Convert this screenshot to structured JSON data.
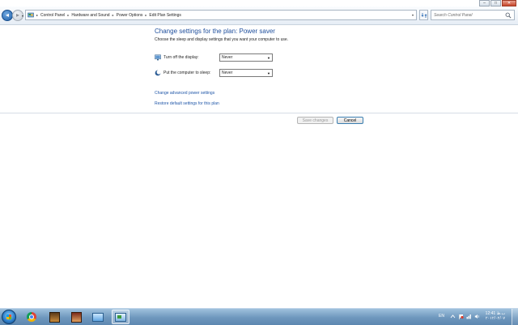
{
  "window_controls": {
    "minimize": "–",
    "maximize": "□",
    "close": "✕"
  },
  "address_bar": {
    "breadcrumbs": [
      "Control Panel",
      "Hardware and Sound",
      "Power Options",
      "Edit Plan Settings"
    ],
    "search_placeholder": "Search Control Panel"
  },
  "content": {
    "title": "Change settings for the plan: Power saver",
    "subtitle": "Choose the sleep and display settings that you want your computer to use.",
    "settings": [
      {
        "label": "Turn off the display:",
        "value": "Never",
        "icon": "monitor-icon"
      },
      {
        "label": "Put the computer to sleep:",
        "value": "Never",
        "icon": "moon-icon"
      }
    ],
    "links": {
      "advanced": "Change advanced power settings",
      "restore": "Restore default settings for this plan"
    },
    "buttons": {
      "save": "Save changes",
      "cancel": "Cancel"
    }
  },
  "taskbar": {
    "apps": [
      "chrome-icon",
      "game-icon",
      "game-icon",
      "remote-desktop-icon",
      "control-panel-icon"
    ],
    "tray": {
      "language": "EN"
    },
    "clock": {
      "time": "12:41 ب.ظ",
      "date": "۲۰۱۲/۰۲/۰۷"
    }
  },
  "colors": {
    "title": "#1e4e9c",
    "link": "#1f56a8",
    "taskbar": "#6e97bd"
  }
}
